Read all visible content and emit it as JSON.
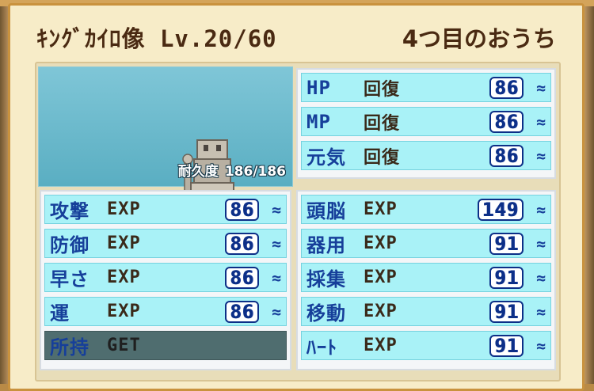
{
  "header": {
    "title": "ｷﾝｸﾞｶｲﾛ像 Lv.20/60",
    "location": "4つ目のおうち"
  },
  "portrait": {
    "durability_label": "耐久度",
    "durability_value": "186/186"
  },
  "recovery": [
    {
      "label": "HP",
      "type": "回復",
      "value": "86",
      "suffix": "≈"
    },
    {
      "label": "MP",
      "type": "回復",
      "value": "86",
      "suffix": "≈"
    },
    {
      "label": "元気",
      "type": "回復",
      "value": "86",
      "suffix": "≈"
    }
  ],
  "left_stats": [
    {
      "label": "攻撃",
      "type": "EXP",
      "value": "86",
      "suffix": "≈"
    },
    {
      "label": "防御",
      "type": "EXP",
      "value": "86",
      "suffix": "≈"
    },
    {
      "label": "早さ",
      "type": "EXP",
      "value": "86",
      "suffix": "≈"
    },
    {
      "label": "運",
      "type": "EXP",
      "value": "86",
      "suffix": "≈"
    },
    {
      "label": "所持",
      "type": "GET",
      "value": "",
      "suffix": ""
    }
  ],
  "right_stats": [
    {
      "label": "頭脳",
      "type": "EXP",
      "value": "149",
      "suffix": "≈"
    },
    {
      "label": "器用",
      "type": "EXP",
      "value": "91",
      "suffix": "≈"
    },
    {
      "label": "採集",
      "type": "EXP",
      "value": "91",
      "suffix": "≈"
    },
    {
      "label": "移動",
      "type": "EXP",
      "value": "91",
      "suffix": "≈"
    },
    {
      "label": "ﾊｰﾄ",
      "type": "EXP",
      "value": "91",
      "suffix": "≈"
    }
  ],
  "colors": {
    "panel": "#f7ecc8",
    "row": "#a9f2f7",
    "label": "#163f9a",
    "value": "#0c2f87",
    "sky": "#7fc6d7"
  }
}
